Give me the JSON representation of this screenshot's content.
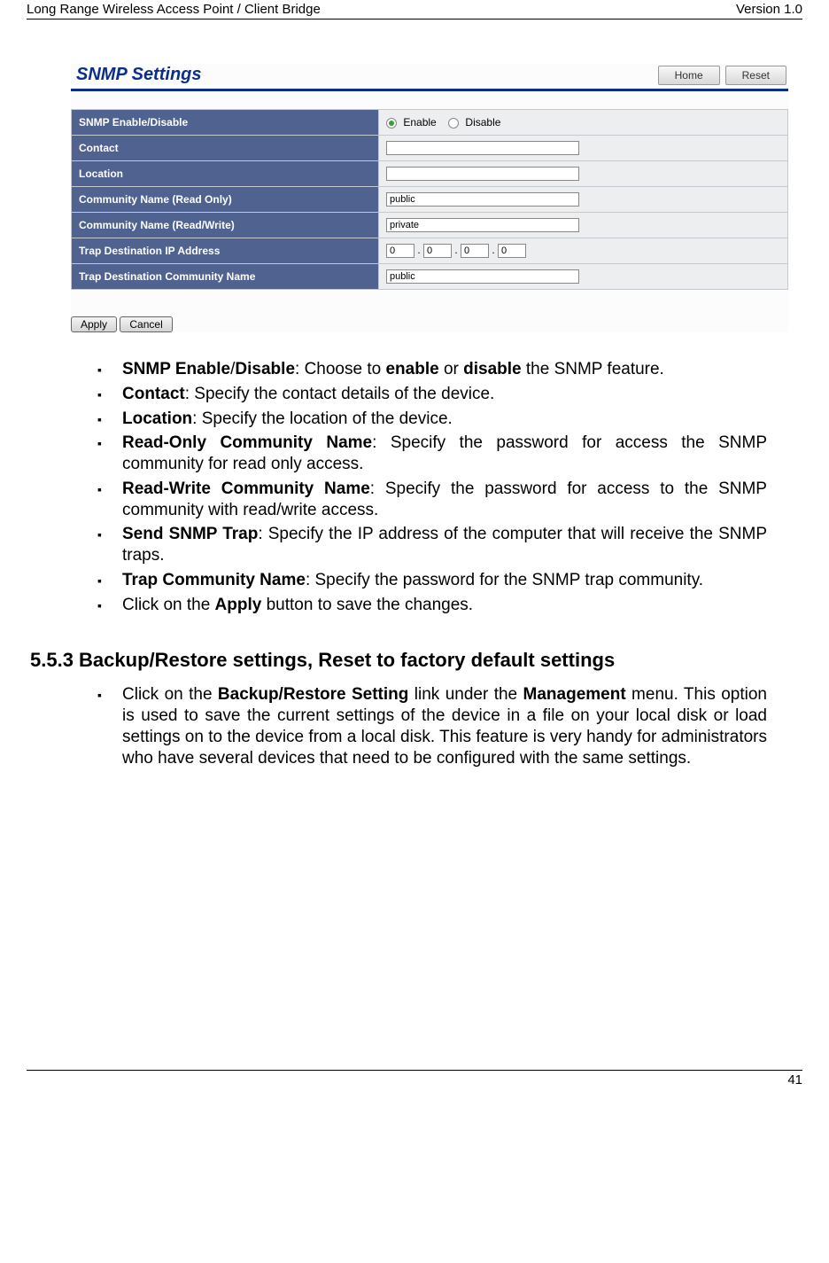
{
  "header": {
    "left": "Long Range Wireless Access Point / Client Bridge",
    "right": "Version 1.0"
  },
  "screenshot": {
    "title": "SNMP Settings",
    "top_buttons": {
      "home": "Home",
      "reset": "Reset"
    },
    "rows": {
      "enable_label": "SNMP Enable/Disable",
      "enable_opt": "Enable",
      "disable_opt": "Disable",
      "contact_label": "Contact",
      "location_label": "Location",
      "community_ro_label": "Community Name (Read Only)",
      "community_ro_value": "public",
      "community_rw_label": "Community Name (Read/Write)",
      "community_rw_value": "private",
      "trap_ip_label": "Trap Destination IP Address",
      "trap_ip": {
        "a": "0",
        "b": "0",
        "c": "0",
        "d": "0"
      },
      "trap_comm_label": "Trap Destination Community Name",
      "trap_comm_value": "public"
    },
    "form_buttons": {
      "apply": "Apply",
      "cancel": "Cancel"
    }
  },
  "bullets1": {
    "b1_bold1": "SNMP Enable",
    "b1_boldslash": "/",
    "b1_bold2": "Disable",
    "b1_pre": ": Choose to ",
    "b1_en": "enable",
    "b1_mid": " or ",
    "b1_dis": "disable",
    "b1_post": " the SNMP feature.",
    "b2_bold": "Contact",
    "b2_rest": ": Specify the contact details of the device.",
    "b3_bold": "Location",
    "b3_rest": ": Specify the location of the device.",
    "b4_bold": "Read-Only Community Name",
    "b4_rest": ": Specify the password for access the SNMP community for read only access.",
    "b5_bold": "Read-Write Community Name",
    "b5_rest": ": Specify the password for access to the SNMP community with read/write access.",
    "b6_bold": "Send SNMP Trap",
    "b6_rest": ": Specify the IP address of the computer that will receive the SNMP traps.",
    "b7_bold": "Trap Community Name",
    "b7_rest": ": Specify the password for the SNMP trap community.",
    "b8_pre": "Click on the ",
    "b8_bold": "Apply",
    "b8_post": " button to save the changes."
  },
  "section": {
    "heading": "5.5.3 Backup/Restore settings, Reset to factory default settings"
  },
  "bullets2": {
    "b1_pre": "Click on the ",
    "b1_bold1": "Backup/Restore Setting",
    "b1_mid": " link under the ",
    "b1_bold2": "Management",
    "b1_post": " menu. This option is used to save the current settings of the device in a file on your local disk or load settings on to the device from a local disk. This feature is very handy for administrators who have several devices that need to be configured with the same settings."
  },
  "footer": {
    "page": "41"
  }
}
